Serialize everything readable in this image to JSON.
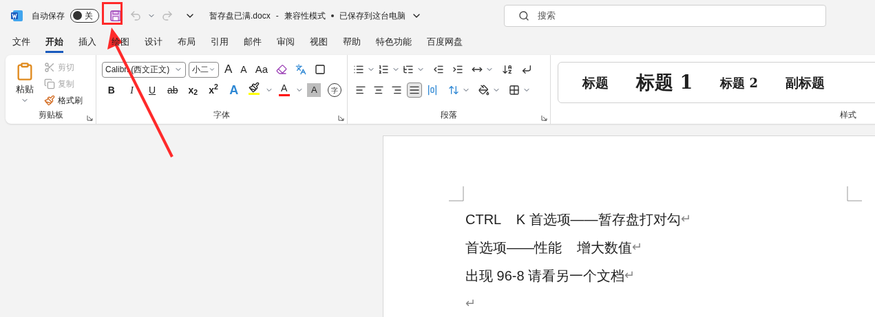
{
  "titlebar": {
    "autosave_label": "自动保存",
    "autosave": {
      "label": "关",
      "on": false
    },
    "document_title": "暂存盘已满.docx",
    "separator": "-",
    "mode": "兼容性模式",
    "save_status": "已保存到这台电脑",
    "search": {
      "placeholder": "搜索"
    }
  },
  "tabs": [
    {
      "label": "文件",
      "selected": false
    },
    {
      "label": "开始",
      "selected": true
    },
    {
      "label": "插入",
      "selected": false
    },
    {
      "label": "绘图",
      "selected": false
    },
    {
      "label": "设计",
      "selected": false
    },
    {
      "label": "布局",
      "selected": false
    },
    {
      "label": "引用",
      "selected": false
    },
    {
      "label": "邮件",
      "selected": false
    },
    {
      "label": "审阅",
      "selected": false
    },
    {
      "label": "视图",
      "selected": false
    },
    {
      "label": "帮助",
      "selected": false
    },
    {
      "label": "特色功能",
      "selected": false
    },
    {
      "label": "百度网盘",
      "selected": false
    }
  ],
  "clipboard": {
    "paste": "粘贴",
    "cut": {
      "label": "剪切",
      "disabled": true
    },
    "copy": {
      "label": "复制",
      "disabled": true
    },
    "format_painter": {
      "label": "格式刷",
      "disabled": false
    },
    "label": "剪贴板"
  },
  "font": {
    "font_name": "Calibri (西文正文)",
    "font_size": "小二",
    "row1": [
      {
        "kind": "grow",
        "text": "A"
      },
      {
        "kind": "shrink",
        "text": "A"
      },
      {
        "kind": "case",
        "text": "Aa"
      }
    ],
    "row2": [
      {
        "kind": "bold",
        "text": "B"
      },
      {
        "kind": "italic",
        "text": "I"
      },
      {
        "kind": "underline",
        "text": "U"
      },
      {
        "kind": "strike",
        "text": "ab"
      },
      {
        "kind": "sub",
        "text": "x$_{2}$"
      },
      {
        "kind": "sup",
        "text": "x$^{2}$"
      }
    ],
    "effects": {
      "text": "A"
    },
    "highlight": {
      "color": "#ffff00"
    },
    "font_color": {
      "text": "A",
      "color": "#ff0000"
    },
    "shading": {
      "text": "A"
    },
    "enclose": {
      "text": "字"
    },
    "label": "字体"
  },
  "paragraph": {
    "alignments": [
      {
        "kind": "left",
        "selected": false
      },
      {
        "kind": "center",
        "selected": false
      },
      {
        "kind": "right",
        "selected": false
      },
      {
        "kind": "justify",
        "selected": true
      },
      {
        "kind": "distributed",
        "selected": false
      }
    ],
    "label": "段落"
  },
  "styles": {
    "items": [
      {
        "kind": "title",
        "text": "标题"
      },
      {
        "kind": "heading1",
        "text": "标题 1"
      },
      {
        "kind": "heading2",
        "text": "标题 2"
      },
      {
        "kind": "subtitle",
        "text": "副标题"
      }
    ],
    "label": "样式"
  },
  "document": {
    "paragraphs": [
      {
        "text": "CTRL    K 首选项——暂存盘打对勾",
        "mark": "↵"
      },
      {
        "text": "首选项——性能    增大数值",
        "mark": "↵"
      },
      {
        "text": "出现 96-8 请看另一个文档",
        "mark": "↵"
      },
      {
        "mark": "↵"
      }
    ]
  }
}
